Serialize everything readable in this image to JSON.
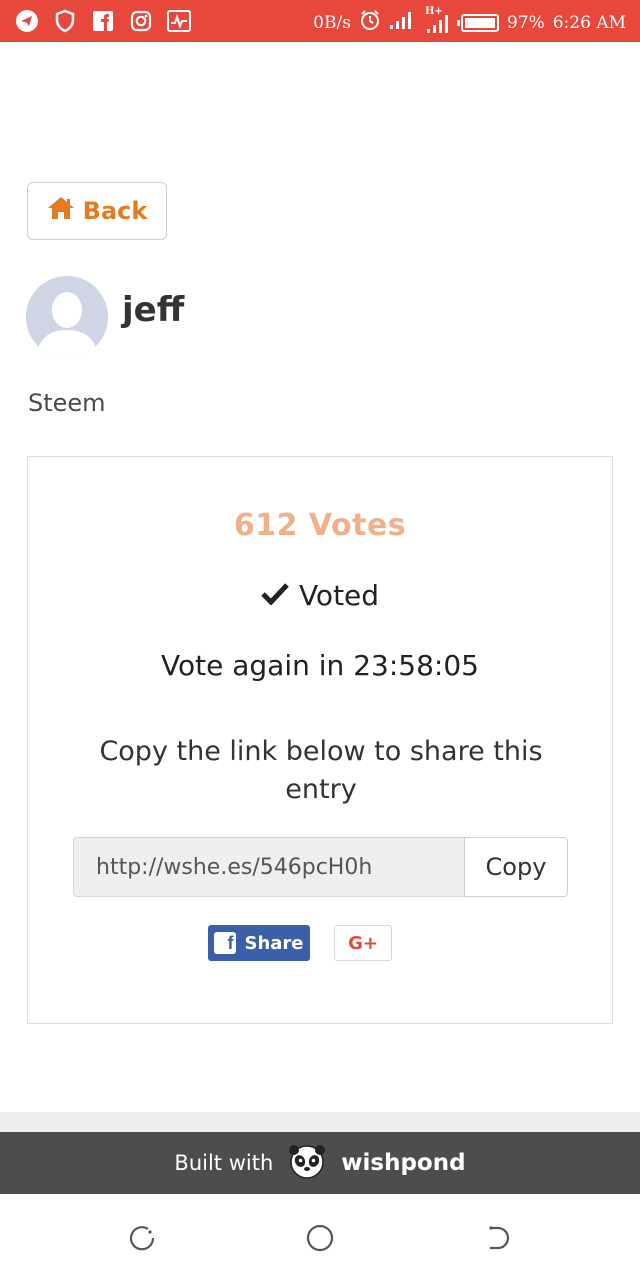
{
  "status_bar": {
    "net_speed": "0B/s",
    "battery_percent": "97%",
    "time": "6:26 AM",
    "network_type": "H+",
    "battery_level": 0.97,
    "background_color": "#e8473c",
    "left_icons": [
      "telegram-icon",
      "shield-icon",
      "facebook-icon",
      "instagram-icon",
      "activity-icon"
    ],
    "right_icons": [
      "alarm-icon",
      "signal-icon",
      "signal-hplus-icon",
      "battery-icon"
    ]
  },
  "back_button": {
    "label": "Back",
    "icon": "home-icon"
  },
  "profile": {
    "name": "jeff",
    "tag": "Steem"
  },
  "card": {
    "votes": "612 Votes",
    "voted_label": "Voted",
    "countdown": "Vote again in 23:58:05",
    "share_note": "Copy the link below to share this entry",
    "link_value": "http://wshe.es/546pcH0h",
    "copy_label": "Copy",
    "facebook_label": "Share",
    "googleplus_label": "G+"
  },
  "footer": {
    "built_with": "Built with",
    "brand": "wishpond"
  },
  "colors": {
    "accent_orange": "#e27b23",
    "votes_color": "#f2b089",
    "facebook_blue": "#3b5fa8",
    "google_red": "#dd4b39",
    "footer_bg": "#4d4d4d"
  }
}
